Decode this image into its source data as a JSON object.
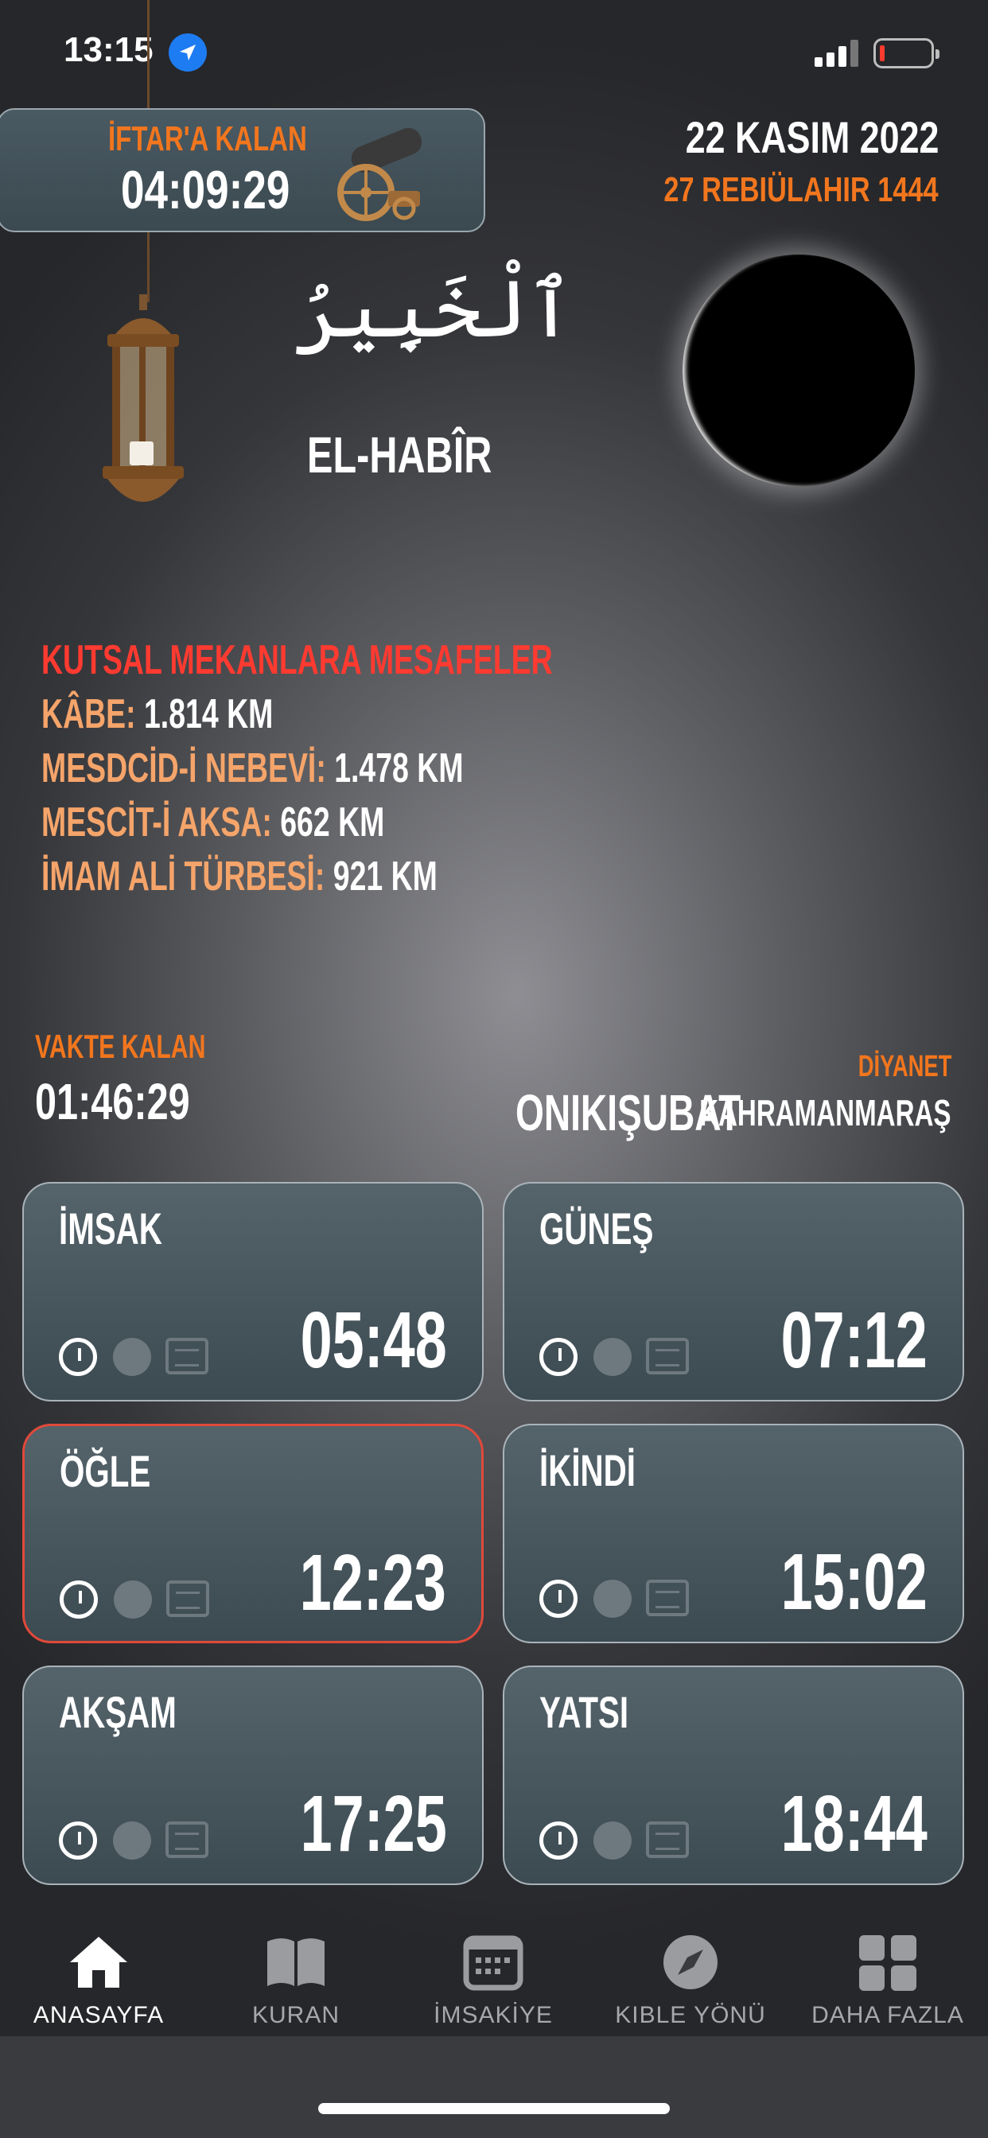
{
  "status_bar": {
    "time": "13:15"
  },
  "iftar": {
    "label": "İFTAR'A KALAN",
    "countdown": "04:09:29"
  },
  "date": {
    "gregorian": "22 KASIM 2022",
    "hijri": "27 REBIÜLAHIR 1444"
  },
  "esma": {
    "arabic": "ٱلْخَبِيرُ",
    "latin": "EL-HABÎR"
  },
  "distances": {
    "title": "KUTSAL MEKANLARA MESAFELER",
    "items": [
      {
        "label": "KÂBE:",
        "value": "1.814 KM"
      },
      {
        "label": "MESDCİD-İ NEBEVİ:",
        "value": "1.478 KM"
      },
      {
        "label": "MESCİT-İ AKSA:",
        "value": "662 KM"
      },
      {
        "label": "İMAM ALİ TÜRBESİ:",
        "value": "921 KM"
      }
    ]
  },
  "remaining": {
    "label": "VAKTE KALAN",
    "value": "01:46:29"
  },
  "location": {
    "source": "DİYANET",
    "district": "ONIKIŞUBAT",
    "city": "KAHRAMANMARAŞ"
  },
  "prayers": [
    {
      "name": "İMSAK",
      "time": "05:48"
    },
    {
      "name": "GÜNEŞ",
      "time": "07:12"
    },
    {
      "name": "ÖĞLE",
      "time": "12:23"
    },
    {
      "name": "İKİNDİ",
      "time": "15:02"
    },
    {
      "name": "AKŞAM",
      "time": "17:25"
    },
    {
      "name": "YATSI",
      "time": "18:44"
    }
  ],
  "tabs": [
    {
      "label": "ANASAYFA",
      "icon": "home-icon"
    },
    {
      "label": "KURAN",
      "icon": "book-icon"
    },
    {
      "label": "İMSAKİYE",
      "icon": "calendar-icon"
    },
    {
      "label": "KIBLE YÖNÜ",
      "icon": "compass-icon"
    },
    {
      "label": "DAHA FAZLA",
      "icon": "grid-icon"
    }
  ],
  "colors": {
    "accent": "#f2761e",
    "alert": "#ff3a30",
    "active_border": "#e0493a"
  }
}
